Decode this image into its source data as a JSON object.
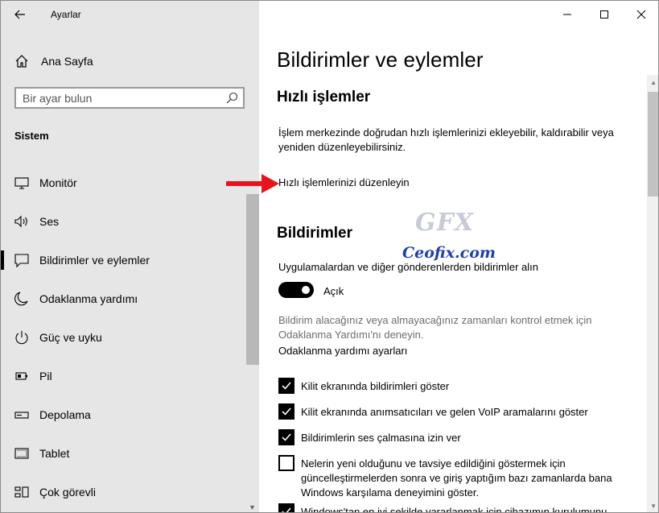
{
  "window": {
    "app_title": "Ayarlar",
    "icons": {
      "back": "back-arrow-icon",
      "minimize": "minimize-icon",
      "maximize": "maximize-icon",
      "close": "close-icon"
    }
  },
  "sidebar": {
    "home_label": "Ana Sayfa",
    "search_placeholder": "Bir ayar bulun",
    "section_label": "Sistem",
    "items": [
      {
        "label": "Monitör",
        "icon": "monitor-icon",
        "active": false
      },
      {
        "label": "Ses",
        "icon": "speaker-icon",
        "active": false
      },
      {
        "label": "Bildirimler ve eylemler",
        "icon": "notification-icon",
        "active": true
      },
      {
        "label": "Odaklanma yardımı",
        "icon": "moon-icon",
        "active": false
      },
      {
        "label": "Güç ve uyku",
        "icon": "power-icon",
        "active": false
      },
      {
        "label": "Pil",
        "icon": "battery-icon",
        "active": false
      },
      {
        "label": "Depolama",
        "icon": "storage-icon",
        "active": false
      },
      {
        "label": "Tablet",
        "icon": "tablet-icon",
        "active": false
      },
      {
        "label": "Çok görevli",
        "icon": "multitask-icon",
        "active": false
      }
    ]
  },
  "main": {
    "page_title": "Bildirimler ve eylemler",
    "quick_actions": {
      "heading": "Hızlı işlemler",
      "description": "İşlem merkezinde doğrudan hızlı işlemlerinizi ekleyebilir, kaldırabilir veya yeniden düzenleyebilirsiniz.",
      "edit_link": "Hızlı işlemlerinizi düzenleyin"
    },
    "notifications": {
      "heading": "Bildirimler",
      "toggle_label": "Uygulamalardan ve diğer gönderenlerden bildirimler alın",
      "toggle_state": "Açık",
      "toggle_on": true,
      "focus_hint": "Bildirim alacağınız veya almayacağınız zamanları kontrol etmek için Odaklanma Yardımı'nı deneyin.",
      "focus_link": "Odaklanma yardımı ayarları",
      "checkboxes": [
        {
          "label": "Kilit ekranında bildirimleri göster",
          "checked": true
        },
        {
          "label": "Kilit ekranında anımsatıcıları ve gelen VoIP aramalarını göster",
          "checked": true
        },
        {
          "label": "Bildirimlerin ses çalmasına izin ver",
          "checked": true
        },
        {
          "label": "Nelerin yeni olduğunu ve tavsiye edildiğini göstermek için güncelleştirmelerden sonra ve giriş yaptığım bazı zamanlarda bana Windows karşılama deneyimini göster.",
          "checked": false
        },
        {
          "label": "Windows'tan en iyi şekilde yararlanmak için cihazımın kurulumunu",
          "checked": true
        }
      ]
    }
  },
  "annotations": {
    "arrow_color": "#e8141c",
    "watermark_logo": "GFX",
    "watermark_text": "Ceofix.com"
  }
}
